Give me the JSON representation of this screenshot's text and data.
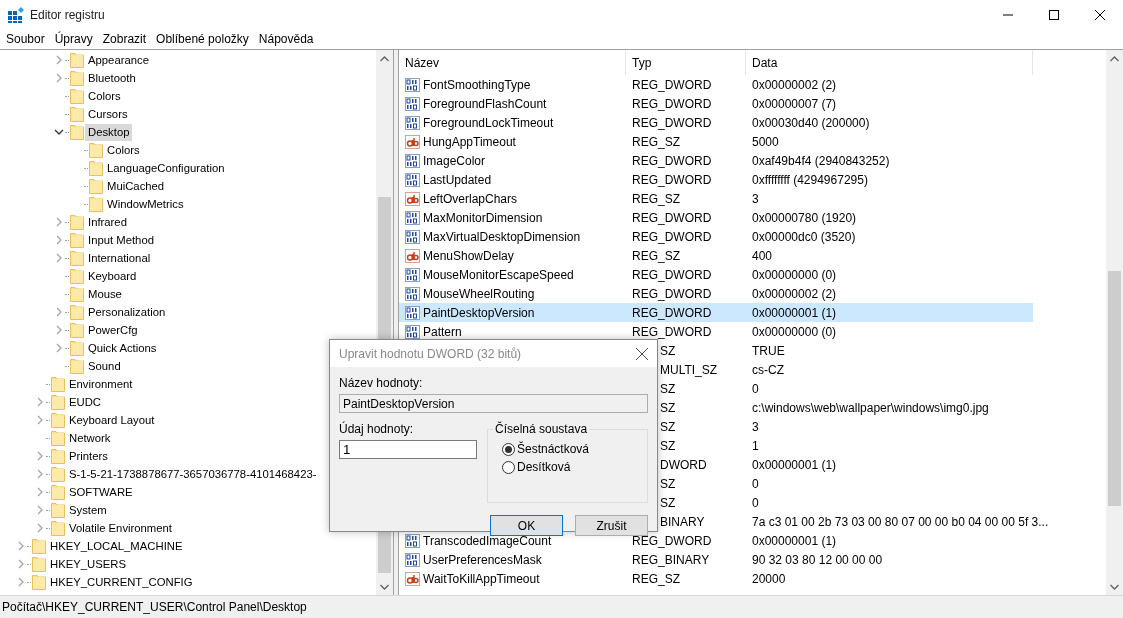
{
  "window": {
    "title": "Editor registru"
  },
  "menu": [
    "Soubor",
    "Úpravy",
    "Zobrazit",
    "Oblíbené položky",
    "Nápověda"
  ],
  "tree": {
    "nodes": [
      {
        "children": [
          {
            "children": [
              {
                "label": "Appearance",
                "expandable": true,
                "expanded": false,
                "selected": false
              },
              {
                "label": "Bluetooth",
                "expandable": true,
                "expanded": false,
                "selected": false
              },
              {
                "label": "Colors",
                "expandable": false,
                "selected": false
              },
              {
                "label": "Cursors",
                "expandable": false,
                "selected": false
              },
              {
                "label": "Desktop",
                "expandable": true,
                "expanded": true,
                "selected": true,
                "children": [
                  {
                    "label": "Colors",
                    "expandable": false,
                    "selected": false
                  },
                  {
                    "label": "LanguageConfiguration",
                    "expandable": false,
                    "selected": false
                  },
                  {
                    "label": "MuiCached",
                    "expandable": false,
                    "selected": false
                  },
                  {
                    "label": "WindowMetrics",
                    "expandable": false,
                    "selected": false
                  }
                ]
              },
              {
                "label": "Infrared",
                "expandable": true,
                "expanded": false,
                "selected": false
              },
              {
                "label": "Input Method",
                "expandable": true,
                "expanded": false,
                "selected": false
              },
              {
                "label": "International",
                "expandable": true,
                "expanded": false,
                "selected": false
              },
              {
                "label": "Keyboard",
                "expandable": false,
                "selected": false
              },
              {
                "label": "Mouse",
                "expandable": false,
                "selected": false
              },
              {
                "label": "Personalization",
                "expandable": true,
                "expanded": false,
                "selected": false
              },
              {
                "label": "PowerCfg",
                "expandable": true,
                "expanded": false,
                "selected": false
              },
              {
                "label": "Quick Actions",
                "expandable": true,
                "expanded": false,
                "selected": false
              },
              {
                "label": "Sound",
                "expandable": false,
                "selected": false
              }
            ]
          },
          {
            "label": "Environment",
            "expandable": false,
            "selected": false
          },
          {
            "label": "EUDC",
            "expandable": true,
            "expanded": false,
            "selected": false
          },
          {
            "label": "Keyboard Layout",
            "expandable": true,
            "expanded": false,
            "selected": false
          },
          {
            "label": "Network",
            "expandable": false,
            "selected": false
          },
          {
            "label": "Printers",
            "expandable": true,
            "expanded": false,
            "selected": false
          },
          {
            "label": "S-1-5-21-1738878677-3657036778-4101468423-",
            "expandable": true,
            "expanded": false,
            "selected": false
          },
          {
            "label": "SOFTWARE",
            "expandable": true,
            "expanded": false,
            "selected": false
          },
          {
            "label": "System",
            "expandable": true,
            "expanded": false,
            "selected": false
          },
          {
            "label": "Volatile Environment",
            "expandable": true,
            "expanded": false,
            "selected": false
          }
        ]
      },
      {
        "label": "HKEY_LOCAL_MACHINE",
        "expandable": true,
        "expanded": false,
        "selected": false
      },
      {
        "label": "HKEY_USERS",
        "expandable": true,
        "expanded": false,
        "selected": false
      },
      {
        "label": "HKEY_CURRENT_CONFIG",
        "expandable": true,
        "expanded": false,
        "selected": false
      }
    ]
  },
  "table": {
    "columns": [
      "Název",
      "Typ",
      "Data"
    ],
    "rows": [
      {
        "kind": "binary",
        "name": "FontSmoothingType",
        "type": "REG_DWORD",
        "data": "0x00000002 (2)",
        "selected": false,
        "covered": false
      },
      {
        "kind": "binary",
        "name": "ForegroundFlashCount",
        "type": "REG_DWORD",
        "data": "0x00000007 (7)",
        "selected": false,
        "covered": false
      },
      {
        "kind": "binary",
        "name": "ForegroundLockTimeout",
        "type": "REG_DWORD",
        "data": "0x00030d40 (200000)",
        "selected": false,
        "covered": false
      },
      {
        "kind": "text",
        "name": "HungAppTimeout",
        "type": "REG_SZ",
        "data": "5000",
        "selected": false,
        "covered": false
      },
      {
        "kind": "binary",
        "name": "ImageColor",
        "type": "REG_DWORD",
        "data": "0xaf49b4f4 (2940843252)",
        "selected": false,
        "covered": false
      },
      {
        "kind": "binary",
        "name": "LastUpdated",
        "type": "REG_DWORD",
        "data": "0xffffffff (4294967295)",
        "selected": false,
        "covered": false
      },
      {
        "kind": "text",
        "name": "LeftOverlapChars",
        "type": "REG_SZ",
        "data": "3",
        "selected": false,
        "covered": false
      },
      {
        "kind": "binary",
        "name": "MaxMonitorDimension",
        "type": "REG_DWORD",
        "data": "0x00000780 (1920)",
        "selected": false,
        "covered": false
      },
      {
        "kind": "binary",
        "name": "MaxVirtualDesktopDimension",
        "type": "REG_DWORD",
        "data": "0x00000dc0 (3520)",
        "selected": false,
        "covered": false
      },
      {
        "kind": "text",
        "name": "MenuShowDelay",
        "type": "REG_SZ",
        "data": "400",
        "selected": false,
        "covered": false
      },
      {
        "kind": "binary",
        "name": "MouseMonitorEscapeSpeed",
        "type": "REG_DWORD",
        "data": "0x00000000 (0)",
        "selected": false,
        "covered": false
      },
      {
        "kind": "binary",
        "name": "MouseWheelRouting",
        "type": "REG_DWORD",
        "data": "0x00000002 (2)",
        "selected": false,
        "covered": false
      },
      {
        "kind": "binary",
        "name": "PaintDesktopVersion",
        "type": "REG_DWORD",
        "data": "0x00000001 (1)",
        "selected": true,
        "covered": false
      },
      {
        "kind": "binary",
        "name": "Pattern",
        "type": "REG_DWORD",
        "data": "0x00000000 (0)",
        "selected": false,
        "covered": false
      },
      {
        "type": "SZ",
        "data": "TRUE",
        "selected": false,
        "covered": true
      },
      {
        "type": "MULTI_SZ",
        "data": "cs-CZ",
        "selected": false,
        "covered": true
      },
      {
        "type": "SZ",
        "data": "0",
        "selected": false,
        "covered": true
      },
      {
        "type": "SZ",
        "data": "c:\\windows\\web\\wallpaper\\windows\\img0.jpg",
        "selected": false,
        "covered": true
      },
      {
        "type": "SZ",
        "data": "3",
        "selected": false,
        "covered": true
      },
      {
        "type": "SZ",
        "data": "1",
        "selected": false,
        "covered": true
      },
      {
        "type": "DWORD",
        "data": "0x00000001 (1)",
        "selected": false,
        "covered": true
      },
      {
        "type": "SZ",
        "data": "0",
        "selected": false,
        "covered": true
      },
      {
        "type": "SZ",
        "data": "0",
        "selected": false,
        "covered": true
      },
      {
        "type": "BINARY",
        "data": "7a c3 01 00 2b 73 03 00 80 07 00 00 b0 04 00 00 5f 3...",
        "selected": false,
        "covered": true
      },
      {
        "kind": "binary",
        "name": "TranscodedImageCount",
        "type": "REG_DWORD",
        "data": "0x00000001 (1)",
        "selected": false,
        "covered": false
      },
      {
        "kind": "binary",
        "name": "UserPreferencesMask",
        "type": "REG_BINARY",
        "data": "90 32 03 80 12 00 00 00",
        "selected": false,
        "covered": false
      },
      {
        "kind": "text",
        "name": "WaitToKillAppTimeout",
        "type": "REG_SZ",
        "data": "20000",
        "selected": false,
        "covered": false
      }
    ]
  },
  "dialog": {
    "title": "Upravit hodnotu DWORD (32 bitů)",
    "name_label": "Název hodnoty:",
    "name_value": "PaintDesktopVersion",
    "data_label": "Údaj hodnoty:",
    "data_value": "1",
    "base_group": "Číselná soustava",
    "radios": [
      {
        "label": "Šestnáctková",
        "selected": true
      },
      {
        "label": "Desítková",
        "selected": false
      }
    ],
    "buttons": [
      {
        "label": "OK",
        "default": true
      },
      {
        "label": "Zrušit",
        "default": false
      }
    ]
  },
  "status_bar": "Počítač\\HKEY_CURRENT_USER\\Control Panel\\Desktop"
}
